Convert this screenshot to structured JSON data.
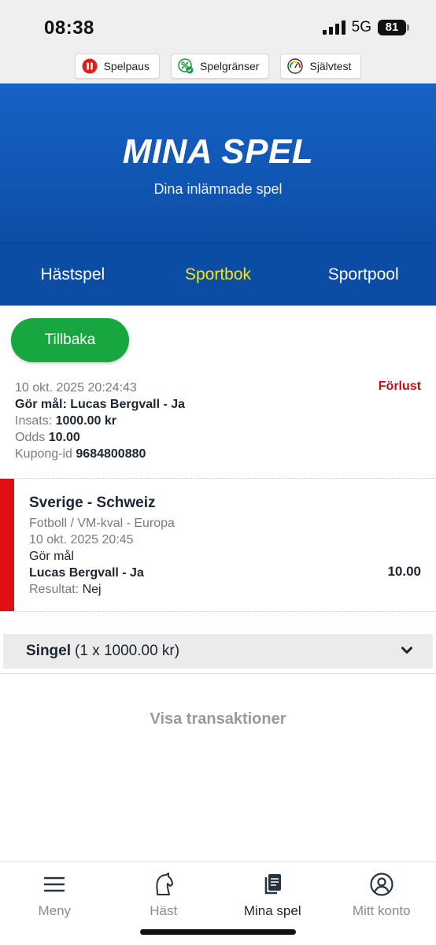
{
  "status": {
    "time": "08:38",
    "network": "5G",
    "battery": "81"
  },
  "rg_buttons": [
    {
      "label": "Spelpaus",
      "icon": "pause-icon"
    },
    {
      "label": "Spelgränser",
      "icon": "limits-icon"
    },
    {
      "label": "Självtest",
      "icon": "gauge-icon"
    }
  ],
  "hero": {
    "title": "MINA SPEL",
    "subtitle": "Dina inlämnade spel"
  },
  "tabs": [
    {
      "label": "Hästspel",
      "active": false
    },
    {
      "label": "Sportbok",
      "active": true
    },
    {
      "label": "Sportpool",
      "active": false
    }
  ],
  "back_label": "Tillbaka",
  "bet": {
    "datetime": "10 okt. 2025 20:24:43",
    "status": "Förlust",
    "selection": "Gör mål: Lucas Bergvall - Ja",
    "stake_label": "Insats:",
    "stake_value": "1000.00 kr",
    "odds_label": "Odds",
    "odds_value": "10.00",
    "coupon_label": "Kupong-id",
    "coupon_value": "9684800880"
  },
  "event": {
    "title": "Sverige - Schweiz",
    "league": "Fotboll / VM-kval - Europa",
    "datetime": "10 okt. 2025 20:45",
    "market": "Gör mål",
    "selection": "Lucas Bergvall - Ja",
    "odds": "10.00",
    "result_label": "Resultat:",
    "result_value": "Nej"
  },
  "singel": {
    "label": "Singel",
    "detail": "(1 x 1000.00 kr)"
  },
  "show_transactions": "Visa transaktioner",
  "nav": [
    {
      "label": "Meny",
      "icon": "menu-icon",
      "active": false
    },
    {
      "label": "Häst",
      "icon": "horse-icon",
      "active": false
    },
    {
      "label": "Mina spel",
      "icon": "coupons-icon",
      "active": true
    },
    {
      "label": "Mitt konto",
      "icon": "user-icon",
      "active": false
    }
  ],
  "colors": {
    "brand_blue": "#0b4da4",
    "active_tab": "#f8e31b",
    "back_green": "#18a640",
    "loss_red": "#d10a10"
  }
}
